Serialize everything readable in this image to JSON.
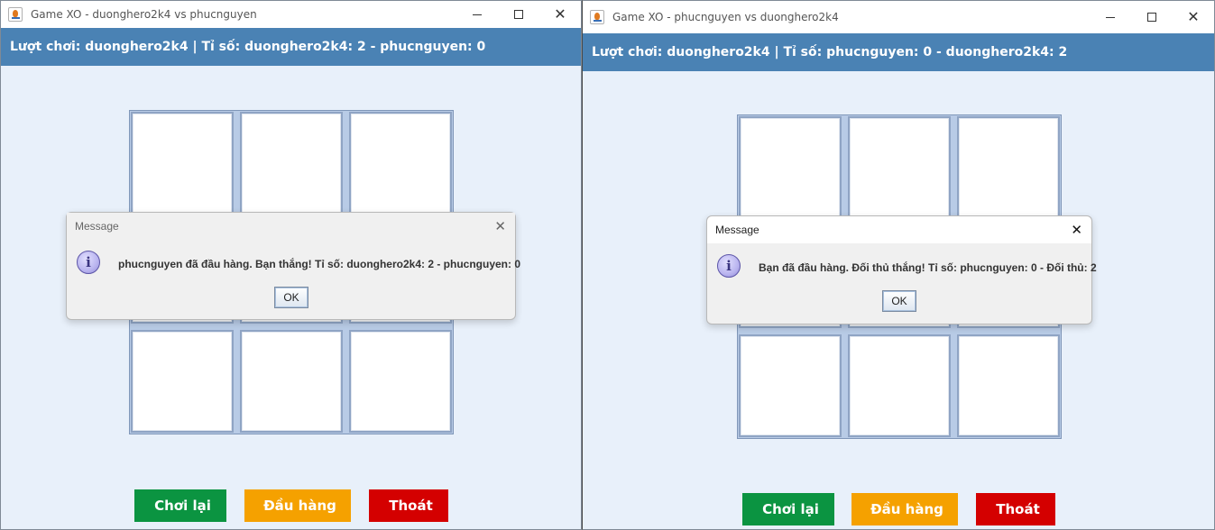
{
  "windows": [
    {
      "title": "Game XO - duonghero2k4 vs phucnguyen",
      "status": "Lượt chơi: duonghero2k4 | Tỉ số: duonghero2k4: 2 - phucnguyen: 0",
      "board": [
        "",
        "",
        "",
        "",
        "",
        "",
        "",
        "",
        ""
      ],
      "dialog": {
        "title": "Message",
        "icon": "information-icon",
        "message": "phucnguyen đã đầu hàng. Bạn thắng! Tỉ số: duonghero2k4: 2 - phucnguyen: 0",
        "ok_label": "OK"
      },
      "buttons": {
        "replay": {
          "glyph": "",
          "label": "Chơi lại",
          "color": "#0b9441"
        },
        "surrender": {
          "glyph": "",
          "label": "Đầu hàng",
          "color": "#f5a100"
        },
        "quit": {
          "glyph": "",
          "label": "Thoát",
          "color": "#d40000"
        }
      }
    },
    {
      "title": "Game XO - phucnguyen vs duonghero2k4",
      "status": "Lượt chơi: duonghero2k4 | Tỉ số: phucnguyen: 0 - duonghero2k4: 2",
      "board": [
        "",
        "",
        "",
        "",
        "",
        "",
        "",
        "",
        ""
      ],
      "dialog": {
        "title": "Message",
        "icon": "information-icon",
        "message": "Bạn đã đầu hàng. Đối thủ thắng! Tỉ số: phucnguyen: 0 - Đối thủ: 2",
        "ok_label": "OK"
      },
      "buttons": {
        "replay": {
          "glyph": "",
          "label": "Chơi lại",
          "color": "#0b9441"
        },
        "surrender": {
          "glyph": "",
          "label": "Đầu hàng",
          "color": "#f5a100"
        },
        "quit": {
          "glyph": "",
          "label": "Thoát",
          "color": "#d40000"
        }
      }
    }
  ],
  "colors": {
    "info_bar": "#4a82b4",
    "window_bg": "#e8f0fa",
    "board_bg": "#b8cbe6"
  }
}
